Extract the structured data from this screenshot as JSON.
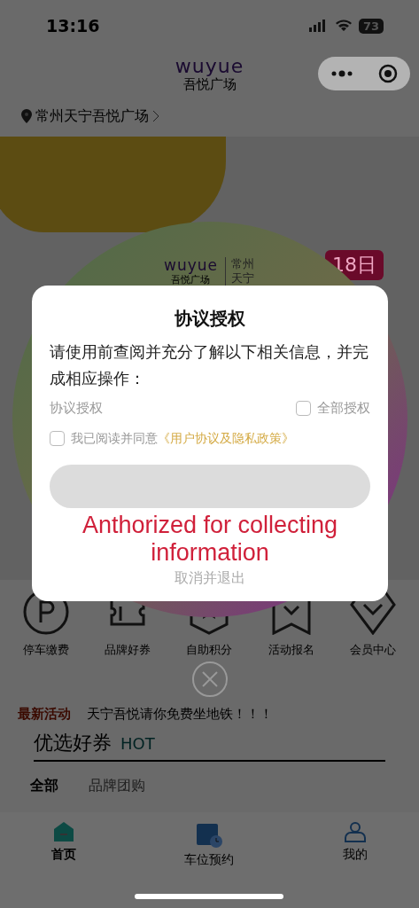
{
  "status_bar": {
    "time": "13:16",
    "battery": "73"
  },
  "header": {
    "logo_word": "wuyue",
    "logo_subtitle": "吾悦广场"
  },
  "location": {
    "name": "常州天宁吾悦广场"
  },
  "banner": {
    "badge": "18日"
  },
  "poster": {
    "logo_word": "wuyue",
    "logo_subtitle": "吾悦广场",
    "city": "常州",
    "district": "天宁"
  },
  "quick_links": [
    {
      "label": "停车缴费",
      "kind": "parking"
    },
    {
      "label": "品牌好券",
      "kind": "ticket"
    },
    {
      "label": "自助积分",
      "kind": "badge"
    },
    {
      "label": "活动报名",
      "kind": "bookmark"
    },
    {
      "label": "会员中心",
      "kind": "shield"
    }
  ],
  "news": {
    "tag": "最新活动",
    "text": "天宁吾悦请你免费坐地铁！！！"
  },
  "coupons": {
    "title": "优选好券",
    "badge": "HOT",
    "tabs": [
      {
        "label": "全部",
        "selected": true
      },
      {
        "label": "品牌团购",
        "selected": false
      }
    ]
  },
  "tab_bar": [
    {
      "label": "首页",
      "kind": "home",
      "selected": true
    },
    {
      "label": "车位预约",
      "kind": "calendar",
      "selected": false
    },
    {
      "label": "我的",
      "kind": "person",
      "selected": false
    }
  ],
  "dialog": {
    "title": "协议授权",
    "message": "请使用前查阅并充分了解以下相关信息，并完成相应操作：",
    "section_label": "协议授权",
    "select_all": {
      "label": "全部授权",
      "checked": false
    },
    "agree": {
      "text": "我已阅读并同意",
      "link": "《用户协议及隐私政策》",
      "checked": false
    },
    "cancel": "取消并退出"
  },
  "annotation": "Anthorized for collecting information"
}
